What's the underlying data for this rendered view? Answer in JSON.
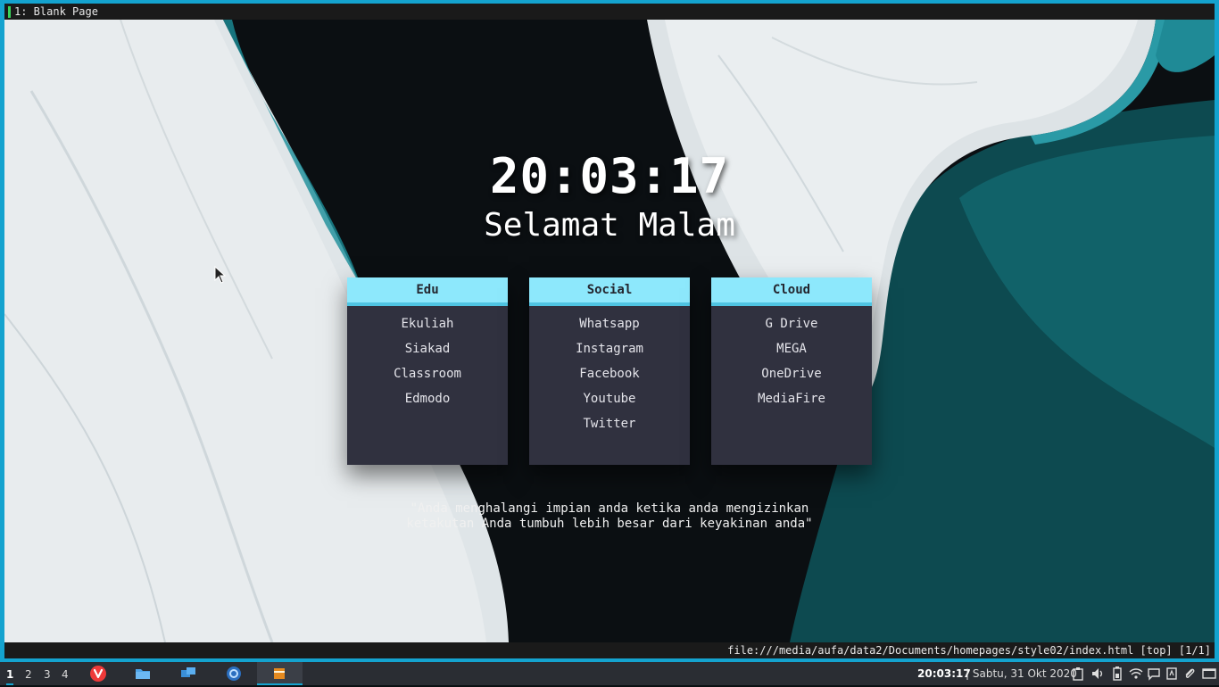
{
  "tab": {
    "title": "1: Blank Page"
  },
  "clock": "20:03:17",
  "greeting": "Selamat Malam",
  "cards": [
    {
      "title": "Edu",
      "links": [
        "Ekuliah",
        "Siakad",
        "Classroom",
        "Edmodo"
      ]
    },
    {
      "title": "Social",
      "links": [
        "Whatsapp",
        "Instagram",
        "Facebook",
        "Youtube",
        "Twitter"
      ]
    },
    {
      "title": "Cloud",
      "links": [
        "G Drive",
        "MEGA",
        "OneDrive",
        "MediaFire"
      ]
    }
  ],
  "quote": {
    "line1": "\"Anda menghalangi impian anda ketika anda mengizinkan",
    "line2": "ketakutan Anda tumbuh lebih besar dari keyakinan anda\""
  },
  "statusbar": {
    "url": "file:///media/aufa/data2/Documents/homepages/style02/index.html [top] [1/1]"
  },
  "taskbar": {
    "workspaces": [
      "1",
      "2",
      "3",
      "4"
    ],
    "active_workspace": "1",
    "apps": [
      "vivaldi-icon",
      "file-manager-icon",
      "remote-desktop-icon",
      "system-settings-icon",
      "media-player-icon"
    ],
    "time": "20:03:17",
    "date": "| Sabtu, 31 Okt 2020",
    "tray": [
      "clipboard-icon",
      "volume-icon",
      "battery-icon",
      "wifi-icon",
      "chat-icon",
      "keyboard-layout-icon",
      "attachment-icon",
      "show-desktop-icon"
    ]
  },
  "colors": {
    "accent": "#14a3cf",
    "card_header": "#8de8fc",
    "card_body": "#30313f",
    "active_tab": "#3ad35a"
  }
}
